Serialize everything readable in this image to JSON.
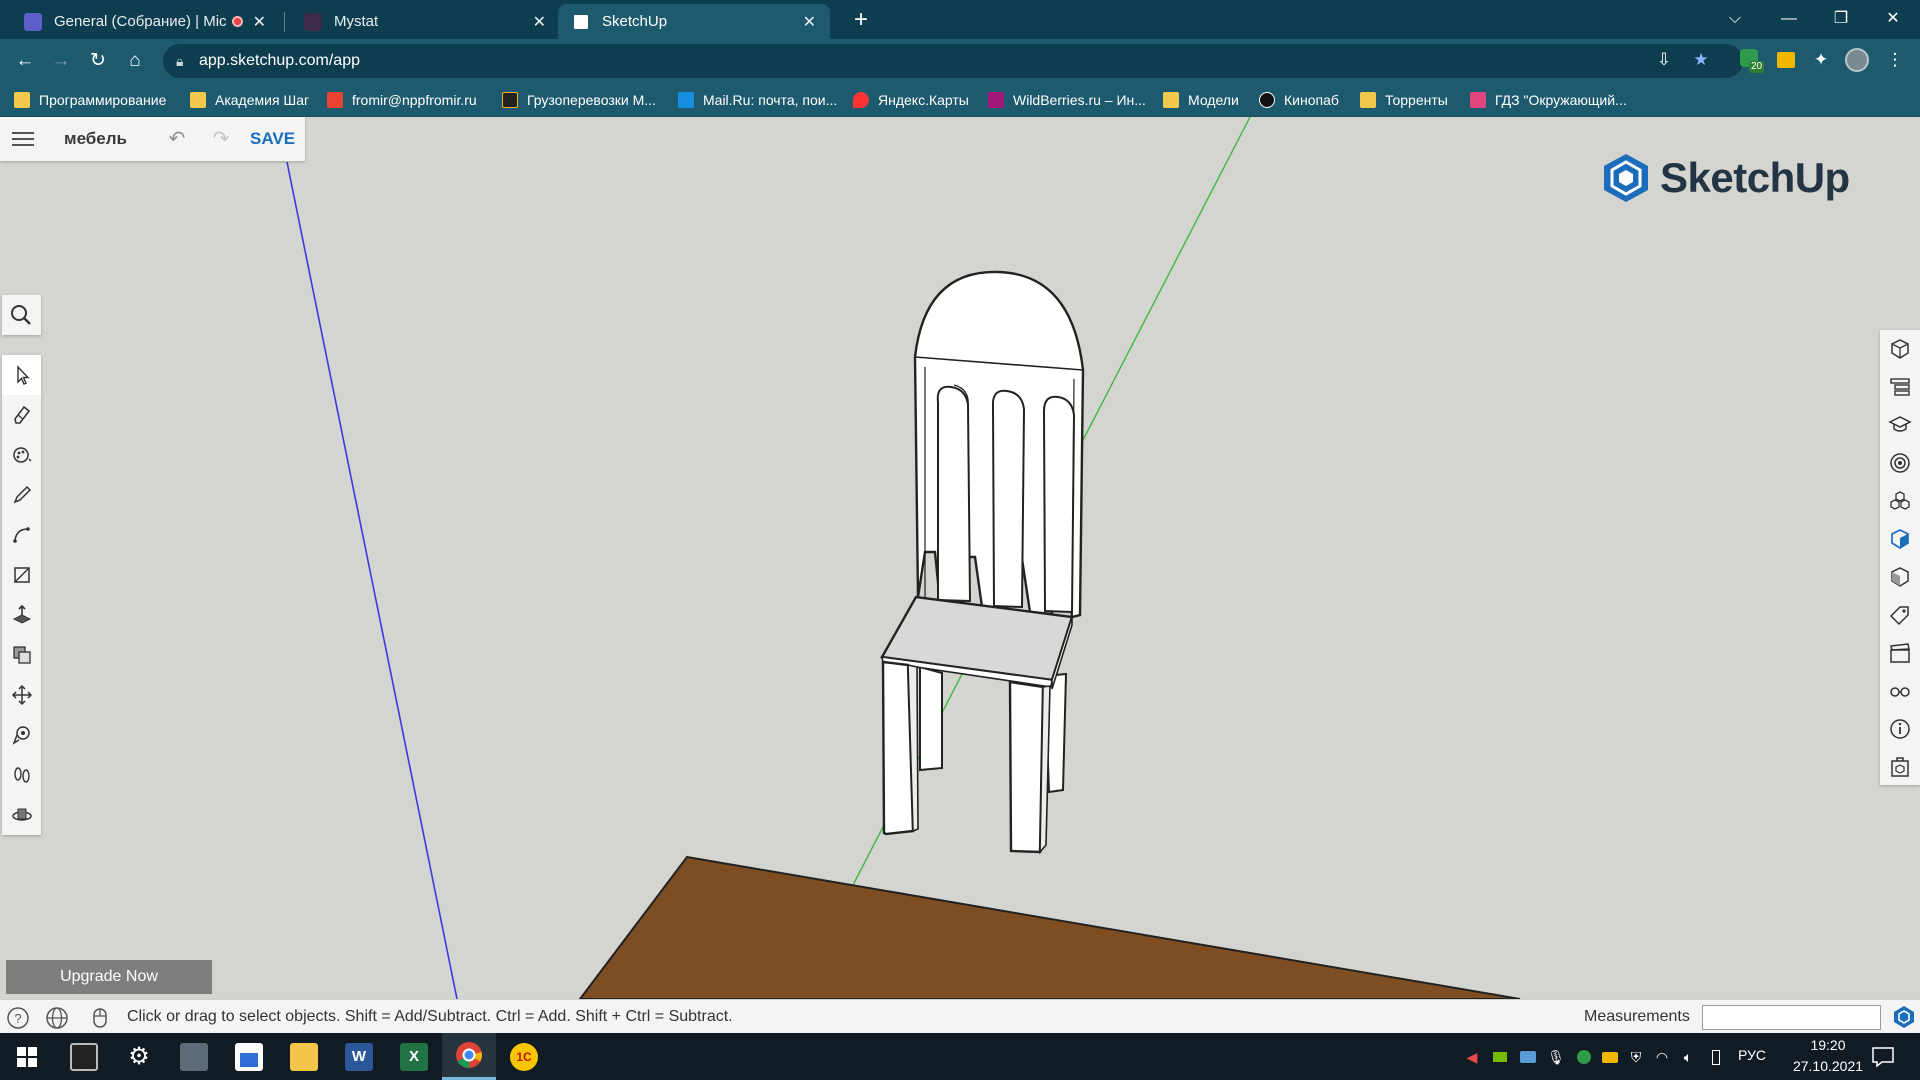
{
  "browser": {
    "tabs": [
      {
        "title": "General (Собрание) | Micros",
        "close": "✕"
      },
      {
        "title": "Mystat",
        "close": "✕"
      },
      {
        "title": "SketchUp",
        "close": "✕"
      }
    ],
    "url": "app.sketchup.com/app",
    "bookmarks": [
      "Программирование",
      "Академия Шаг",
      "fromir@nppfromir.ru",
      "Грузоперевозки М...",
      "Mail.Ru: почта, пои...",
      "Яндекс.Карты",
      "WildBerries.ru – Ин...",
      "Модели",
      "Кинопаб",
      "Торренты",
      "ГДЗ \"Окружающий..."
    ],
    "extension_badge": "20"
  },
  "app": {
    "model_name": "мебель",
    "save_label": "SAVE",
    "logo_text": "SketchUp",
    "upgrade_label": "Upgrade Now",
    "left_tools": [
      "select-tool",
      "eraser-tool",
      "paint-bucket-tool",
      "pencil-tool",
      "arc-tool",
      "rectangle-tool",
      "push-pull-tool",
      "offset-tool",
      "move-tool",
      "tape-measure-tool",
      "walk-tool",
      "orbit-tool"
    ],
    "right_tools": [
      "entity-info",
      "outliner",
      "instructor",
      "materials",
      "components",
      "styles",
      "views",
      "tags",
      "scenes",
      "display",
      "info",
      "3d-warehouse"
    ],
    "colors": {
      "background": "#d4d4d0",
      "floor": "#7f4d22",
      "chair": "#ffffff",
      "seat": "#d8d8d8",
      "blue_axis": "#3a3ae0",
      "green_axis": "#3dbb3d",
      "accent": "#1b6dbb"
    }
  },
  "statusbar": {
    "hint": "Click or drag to select objects. Shift = Add/Subtract. Ctrl = Add. Shift + Ctrl = Subtract.",
    "measurements_label": "Measurements",
    "measurements_value": ""
  },
  "taskbar": {
    "language": "РУС",
    "time": "19:20",
    "date": "27.10.2021",
    "apps": [
      "start",
      "terminal",
      "settings",
      "calculator",
      "store",
      "explorer",
      "word",
      "excel",
      "chrome",
      "1c"
    ]
  }
}
